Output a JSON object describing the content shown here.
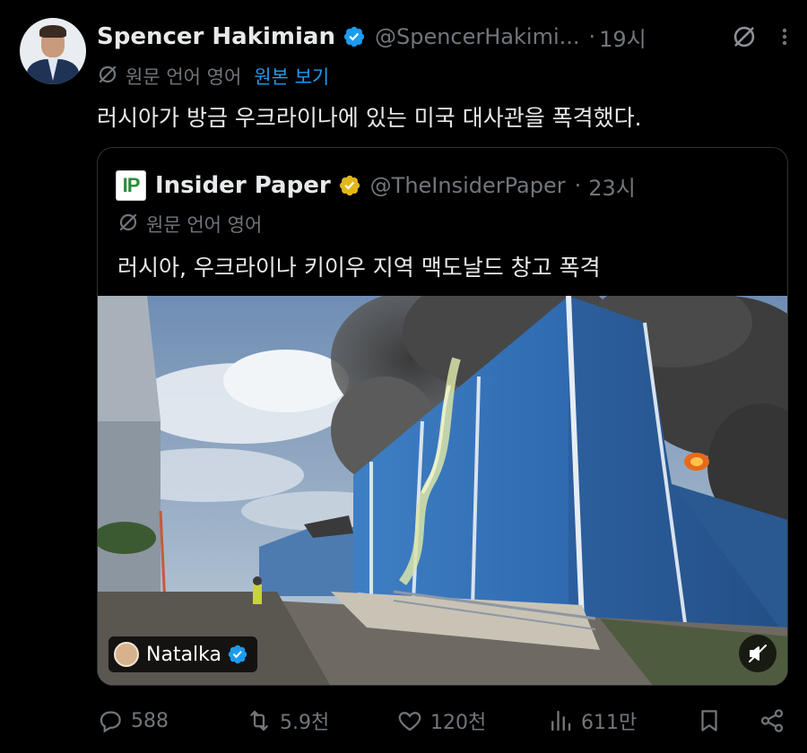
{
  "tweet": {
    "author_name": "Spencer Hakimian",
    "handle": "@SpencerHakimi...",
    "separator": "·",
    "time": "19시",
    "translated_from": "원문 언어 영어",
    "show_original": "원본 보기",
    "text": "러시아가 방금 우크라이나에 있는 미국 대사관을 폭격했다."
  },
  "quote": {
    "logo_text": "IP",
    "author_name": "Insider Paper",
    "handle": "@TheInsiderPaper",
    "separator": "·",
    "time": "23시",
    "translated_from": "원문 언어 영어",
    "text": "러시아, 우크라이나 키이우 지역 맥도날드 창고 폭격",
    "media": {
      "credit_name": "Natalka"
    }
  },
  "actions": {
    "replies": "588",
    "retweets": "5.9천",
    "likes": "120천",
    "views": "611만"
  },
  "colors": {
    "background": "#000000",
    "text": "#e7e9ea",
    "muted": "#71767b",
    "link": "#1d9bf0",
    "verified_blue": "#1d9bf0",
    "verified_gold": "#e2b719",
    "border": "#2f3336"
  },
  "icons": [
    "grok-translate-icon",
    "more-icon",
    "verified-badge-icon",
    "reply-icon",
    "retweet-icon",
    "like-icon",
    "views-icon",
    "bookmark-icon",
    "share-icon",
    "mute-icon"
  ]
}
